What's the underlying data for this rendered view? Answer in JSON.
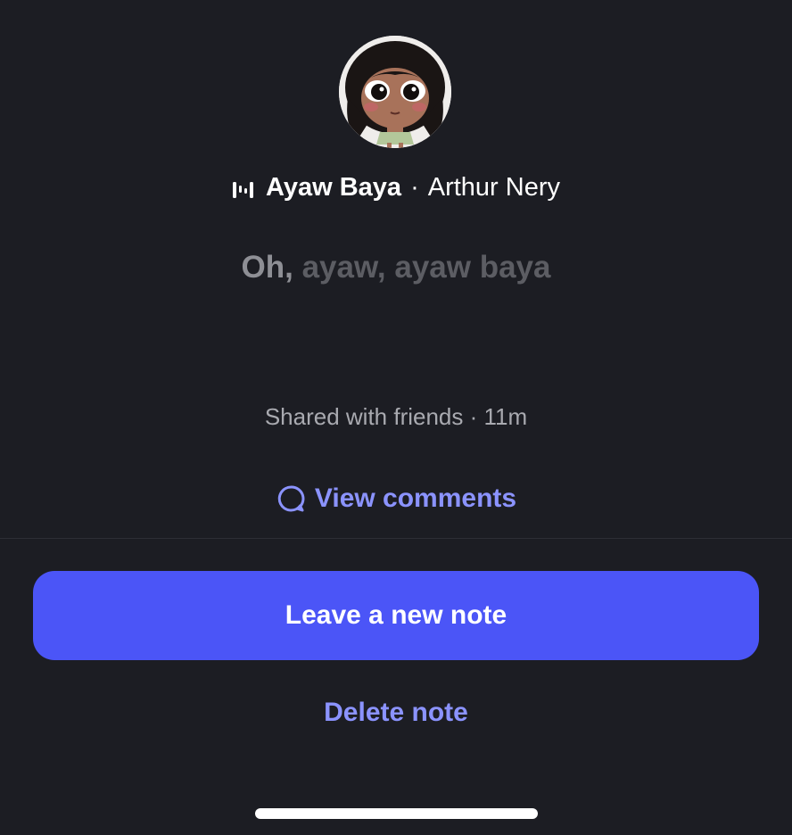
{
  "note": {
    "avatar": {
      "icon": "cartoon-girl-avatar"
    },
    "song": {
      "icon": "music-bars-icon",
      "title": "Ayaw Baya",
      "separator": "·",
      "artist": "Arthur Nery"
    },
    "lyric": {
      "active": "Oh,",
      "rest": "ayaw, ayaw baya"
    },
    "shared_text": "Shared with friends · 11m",
    "comments": {
      "icon": "speech-bubble-icon",
      "label": "View comments"
    }
  },
  "actions": {
    "primary_label": "Leave a new note",
    "delete_label": "Delete note"
  },
  "colors": {
    "background": "#1c1d23",
    "accent": "#4b55f7",
    "link": "#8b93ff"
  }
}
